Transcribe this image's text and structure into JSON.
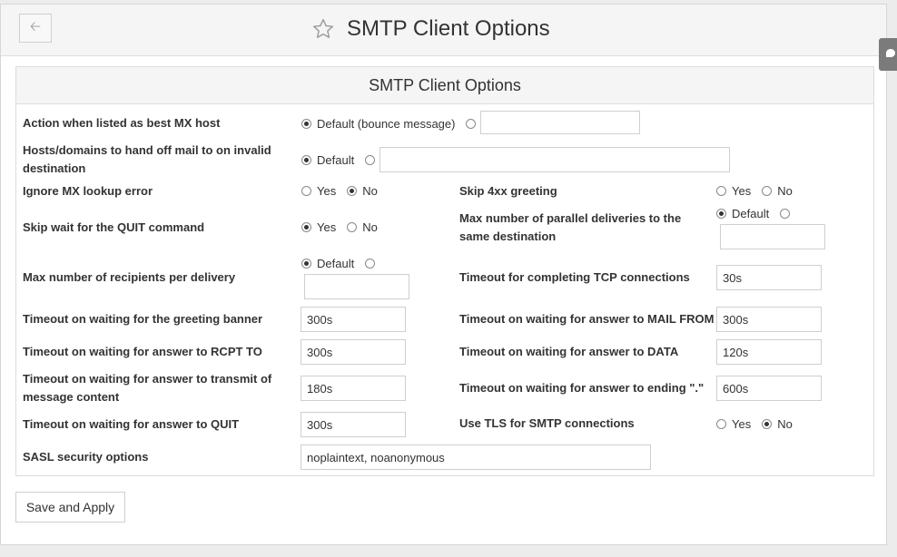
{
  "header": {
    "title": "SMTP Client Options"
  },
  "panel": {
    "title": "SMTP Client Options"
  },
  "fields": {
    "best_mx": {
      "label": "Action when listed as best MX host",
      "default_label": "Default (bounce message)",
      "custom_value": ""
    },
    "handoff": {
      "label": "Hosts/domains to hand off mail to on invalid destination",
      "default_label": "Default",
      "custom_value": ""
    },
    "ignore_mx": {
      "label": "Ignore MX lookup error",
      "yes": "Yes",
      "no": "No"
    },
    "skip_4xx": {
      "label": "Skip 4xx greeting",
      "yes": "Yes",
      "no": "No"
    },
    "skip_quit": {
      "label": "Skip wait for the QUIT command",
      "yes": "Yes",
      "no": "No"
    },
    "max_parallel": {
      "label": "Max number of parallel deliveries to the same destination",
      "default_label": "Default",
      "custom_value": ""
    },
    "max_recipients": {
      "label": "Max number of recipients per delivery",
      "default_label": "Default",
      "custom_value": ""
    },
    "timeout_tcp": {
      "label": "Timeout for completing TCP connections",
      "value": "30s"
    },
    "timeout_banner": {
      "label": "Timeout on waiting for the greeting banner",
      "value": "300s"
    },
    "timeout_mailfrom": {
      "label": "Timeout on waiting for answer to MAIL FROM",
      "value": "300s"
    },
    "timeout_rcpt": {
      "label": "Timeout on waiting for answer to RCPT TO",
      "value": "300s"
    },
    "timeout_data": {
      "label": "Timeout on waiting for answer to DATA",
      "value": "120s"
    },
    "timeout_transmit": {
      "label": "Timeout on waiting for answer to transmit of message content",
      "value": "180s"
    },
    "timeout_ending": {
      "label": "Timeout on waiting for answer to ending \".\"",
      "value": "600s"
    },
    "timeout_quit": {
      "label": "Timeout on waiting for answer to QUIT",
      "value": "300s"
    },
    "use_tls": {
      "label": "Use TLS for SMTP connections",
      "yes": "Yes",
      "no": "No"
    },
    "sasl": {
      "label": "SASL security options",
      "value": "noplaintext, noanonymous"
    }
  },
  "save_label": "Save and Apply"
}
